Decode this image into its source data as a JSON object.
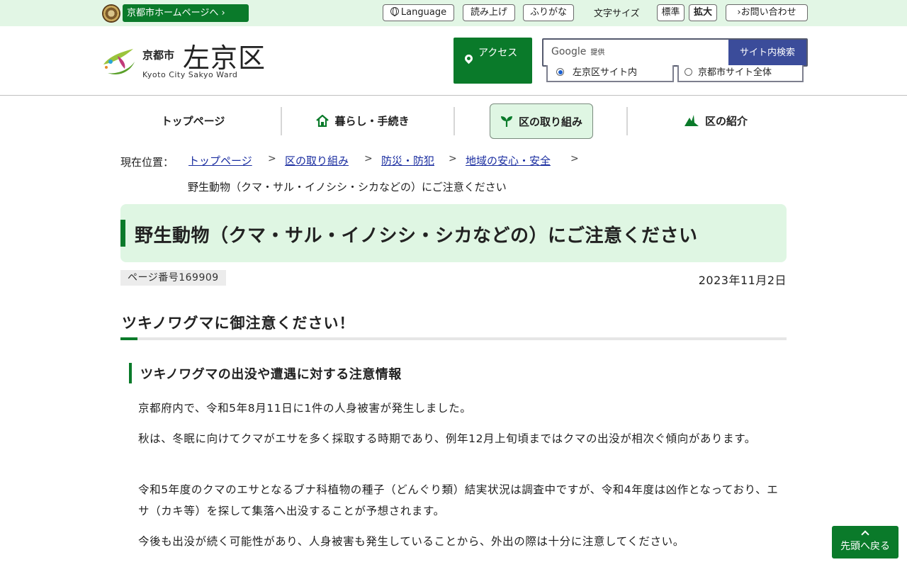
{
  "topbar": {
    "city_home": "京都市ホームページへ ›",
    "language": "Language",
    "read_aloud": "読み上げ",
    "furigana": "ふりがな",
    "font_size_label": "文字サイズ",
    "font_standard": "標準",
    "font_large": "拡大",
    "contact": "›お問い合わせ"
  },
  "header": {
    "logo_small": "京都市",
    "logo_big": "左京区",
    "logo_en": "Kyoto City Sakyo Ward",
    "access": "アクセス",
    "search": {
      "google": "Google",
      "provided": "提供",
      "button": "サイト内検索",
      "value": "",
      "scope_ward": "左京区サイト内",
      "scope_city": "京都市サイト全体"
    }
  },
  "nav": {
    "top": "トップページ",
    "living": "暮らし・手続き",
    "initiatives": "区の取り組み",
    "intro": "区の紹介"
  },
  "breadcrumb": {
    "label": "現在位置：",
    "items": [
      "トップページ",
      "区の取り組み",
      "防災・防犯",
      "地域の安心・安全"
    ],
    "current": "野生動物（クマ・サル・イノシシ・シカなどの）にご注意ください"
  },
  "article": {
    "title": "野生動物（クマ・サル・イノシシ・シカなどの）にご注意ください",
    "page_number": "ページ番号169909",
    "date": "2023年11月2日",
    "h2": "ツキノワグマに御注意ください！",
    "h3": "ツキノワグマの出没や遭遇に対する注意情報",
    "paragraphs": [
      "京都府内で、令和5年8月11日に1件の人身被害が発生しました。",
      "秋は、冬眠に向けてクマがエサを多く採取する時期であり、例年12月上旬頃まではクマの出没が相次ぐ傾向があります。",
      "令和5年度のクマのエサとなるブナ科植物の種子（どんぐり類）結実状況は調査中ですが、令和4年度は凶作となっており、エサ（カキ等）を探して集落へ出没することが予想されます。",
      "今後も出没が続く可能性があり、人身被害も発生していることから、外出の際は十分に注意してください。"
    ]
  },
  "pagetop": "先頭へ戻る",
  "colors": {
    "brand_green": "#0a7a2a",
    "light_green": "#dff6e3",
    "search_blue": "#3b4c9a",
    "link_blue": "#1a2da0"
  }
}
